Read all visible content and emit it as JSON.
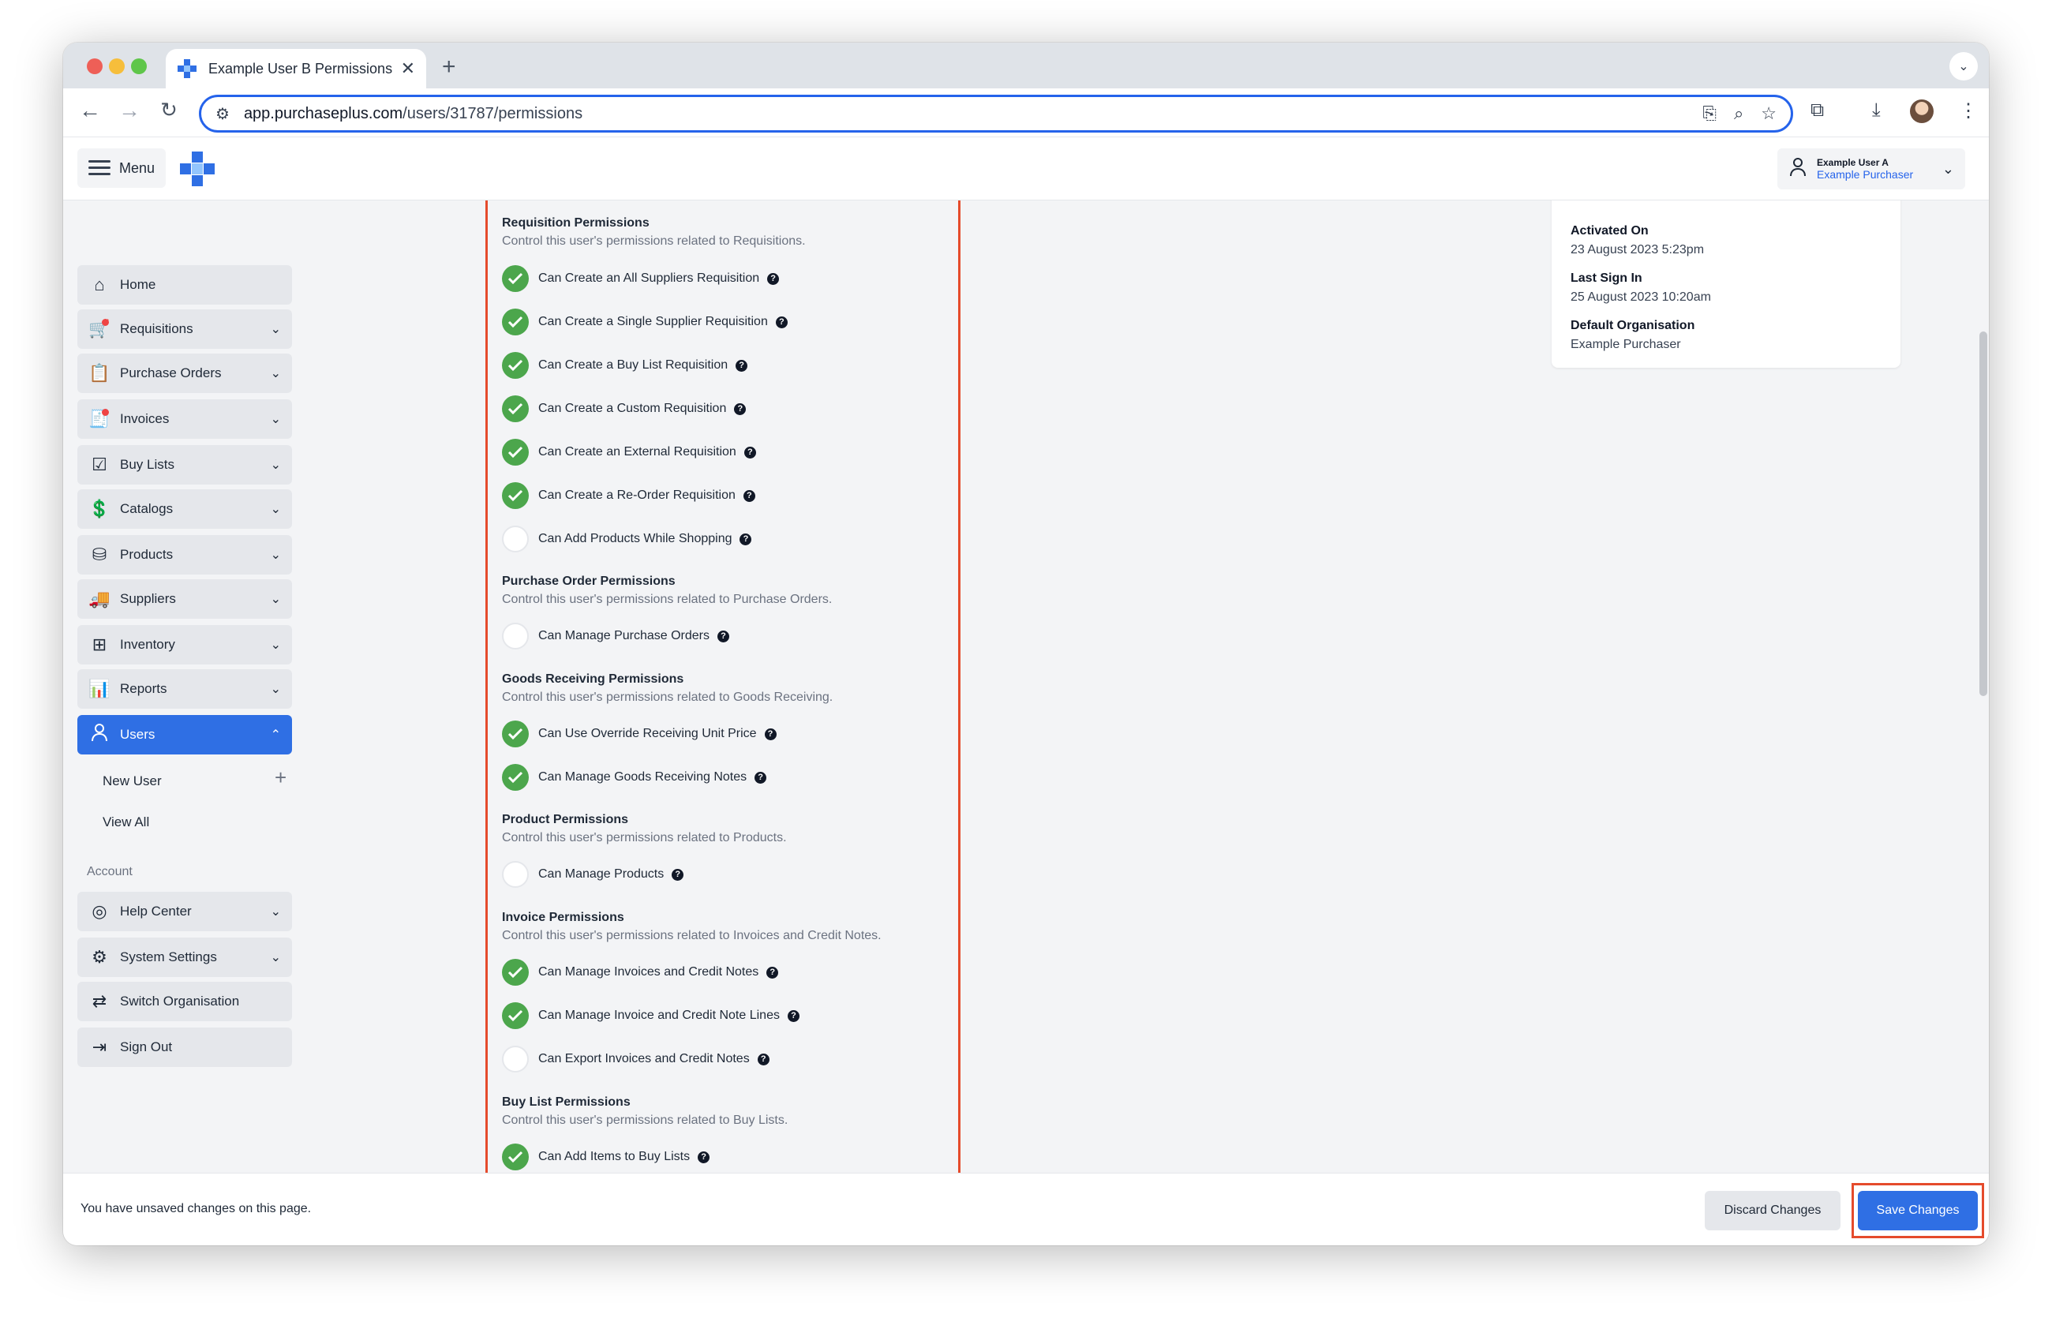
{
  "browser": {
    "tab_title": "Example User B Permissions",
    "url_host": "app.purchaseplus.com",
    "url_path": "/users/31787/permissions"
  },
  "header": {
    "menu_label": "Menu",
    "user_name": "Example User A",
    "user_org": "Example Purchaser"
  },
  "sidebar": {
    "items": [
      {
        "label": "Home",
        "icon": "home-icon"
      },
      {
        "label": "Requisitions",
        "icon": "cart-icon"
      },
      {
        "label": "Purchase Orders",
        "icon": "clipboard-icon"
      },
      {
        "label": "Invoices",
        "icon": "invoice-icon"
      },
      {
        "label": "Buy Lists",
        "icon": "checklist-icon"
      },
      {
        "label": "Catalogs",
        "icon": "catalog-icon"
      },
      {
        "label": "Products",
        "icon": "box-icon"
      },
      {
        "label": "Suppliers",
        "icon": "truck-icon"
      },
      {
        "label": "Inventory",
        "icon": "inventory-icon"
      },
      {
        "label": "Reports",
        "icon": "chart-icon"
      },
      {
        "label": "Users",
        "icon": "user-icon"
      }
    ],
    "sub_items": [
      "New User",
      "View All"
    ],
    "account_label": "Account",
    "account_items": [
      {
        "label": "Help Center",
        "icon": "lifebuoy-icon"
      },
      {
        "label": "System Settings",
        "icon": "gear-icon"
      },
      {
        "label": "Switch Organisation",
        "icon": "switch-icon"
      },
      {
        "label": "Sign Out",
        "icon": "sign-out-icon"
      }
    ]
  },
  "permissions": {
    "requisition": {
      "title": "Requisition Permissions",
      "desc": "Control this user's permissions related to Requisitions.",
      "items": [
        {
          "label": "Can Create an All Suppliers Requisition",
          "checked": true
        },
        {
          "label": "Can Create a Single Supplier Requisition",
          "checked": true
        },
        {
          "label": "Can Create a Buy List Requisition",
          "checked": true
        },
        {
          "label": "Can Create a Custom Requisition",
          "checked": true
        },
        {
          "label": "Can Create an External Requisition",
          "checked": true
        },
        {
          "label": "Can Create a Re-Order Requisition",
          "checked": true
        },
        {
          "label": "Can Add Products While Shopping",
          "checked": false
        }
      ]
    },
    "purchase_order": {
      "title": "Purchase Order Permissions",
      "desc": "Control this user's permissions related to Purchase Orders.",
      "items": [
        {
          "label": "Can Manage Purchase Orders",
          "checked": false
        }
      ]
    },
    "goods_receiving": {
      "title": "Goods Receiving Permissions",
      "desc": "Control this user's permissions related to Goods Receiving.",
      "items": [
        {
          "label": "Can Use Override Receiving Unit Price",
          "checked": true
        },
        {
          "label": "Can Manage Goods Receiving Notes",
          "checked": true
        }
      ]
    },
    "product": {
      "title": "Product Permissions",
      "desc": "Control this user's permissions related to Products.",
      "items": [
        {
          "label": "Can Manage Products",
          "checked": false
        }
      ]
    },
    "invoice": {
      "title": "Invoice Permissions",
      "desc": "Control this user's permissions related to Invoices and Credit Notes.",
      "items": [
        {
          "label": "Can Manage Invoices and Credit Notes",
          "checked": true
        },
        {
          "label": "Can Manage Invoice and Credit Note Lines",
          "checked": true
        },
        {
          "label": "Can Export Invoices and Credit Notes",
          "checked": false
        }
      ]
    },
    "buy_list": {
      "title": "Buy List Permissions",
      "desc": "Control this user's permissions related to Buy Lists.",
      "items": [
        {
          "label": "Can Add Items to Buy Lists",
          "checked": true
        }
      ]
    }
  },
  "info": {
    "activated_label": "Activated On",
    "activated_value": "23 August 2023 5:23pm",
    "last_sign_in_label": "Last Sign In",
    "last_sign_in_value": "25 August 2023 10:20am",
    "default_org_label": "Default Organisation",
    "default_org_value": "Example Purchaser"
  },
  "footer": {
    "message": "You have unsaved changes on this page.",
    "discard_label": "Discard Changes",
    "save_label": "Save Changes"
  },
  "colors": {
    "accent": "#2f6fe4",
    "check_green": "#4ca64c",
    "highlight_red": "#e54b2c"
  }
}
